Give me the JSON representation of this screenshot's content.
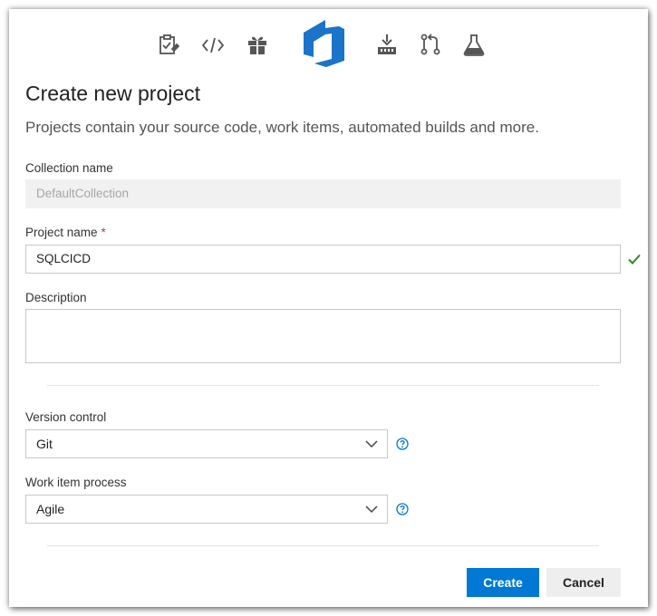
{
  "header": {
    "service_icons": [
      "boards-icon",
      "code-icon",
      "artifacts-icon",
      "azure-devops-logo-icon",
      "pipelines-icon",
      "pull-request-icon",
      "test-plans-icon"
    ],
    "title": "Create new project",
    "subtitle": "Projects contain your source code, work items, automated builds and more."
  },
  "form": {
    "collection": {
      "label": "Collection name",
      "value": "DefaultCollection"
    },
    "project": {
      "label": "Project name",
      "required_marker": "*",
      "value": "SQLCICD"
    },
    "description": {
      "label": "Description",
      "value": ""
    },
    "version_control": {
      "label": "Version control",
      "selected": "Git"
    },
    "work_item_process": {
      "label": "Work item process",
      "selected": "Agile"
    }
  },
  "actions": {
    "create_label": "Create",
    "cancel_label": "Cancel"
  },
  "colors": {
    "accent": "#0078d4",
    "logo": "#1b74c9",
    "valid_check": "#2a8a2a",
    "required": "#c43535",
    "icon_gray": "#555555"
  }
}
